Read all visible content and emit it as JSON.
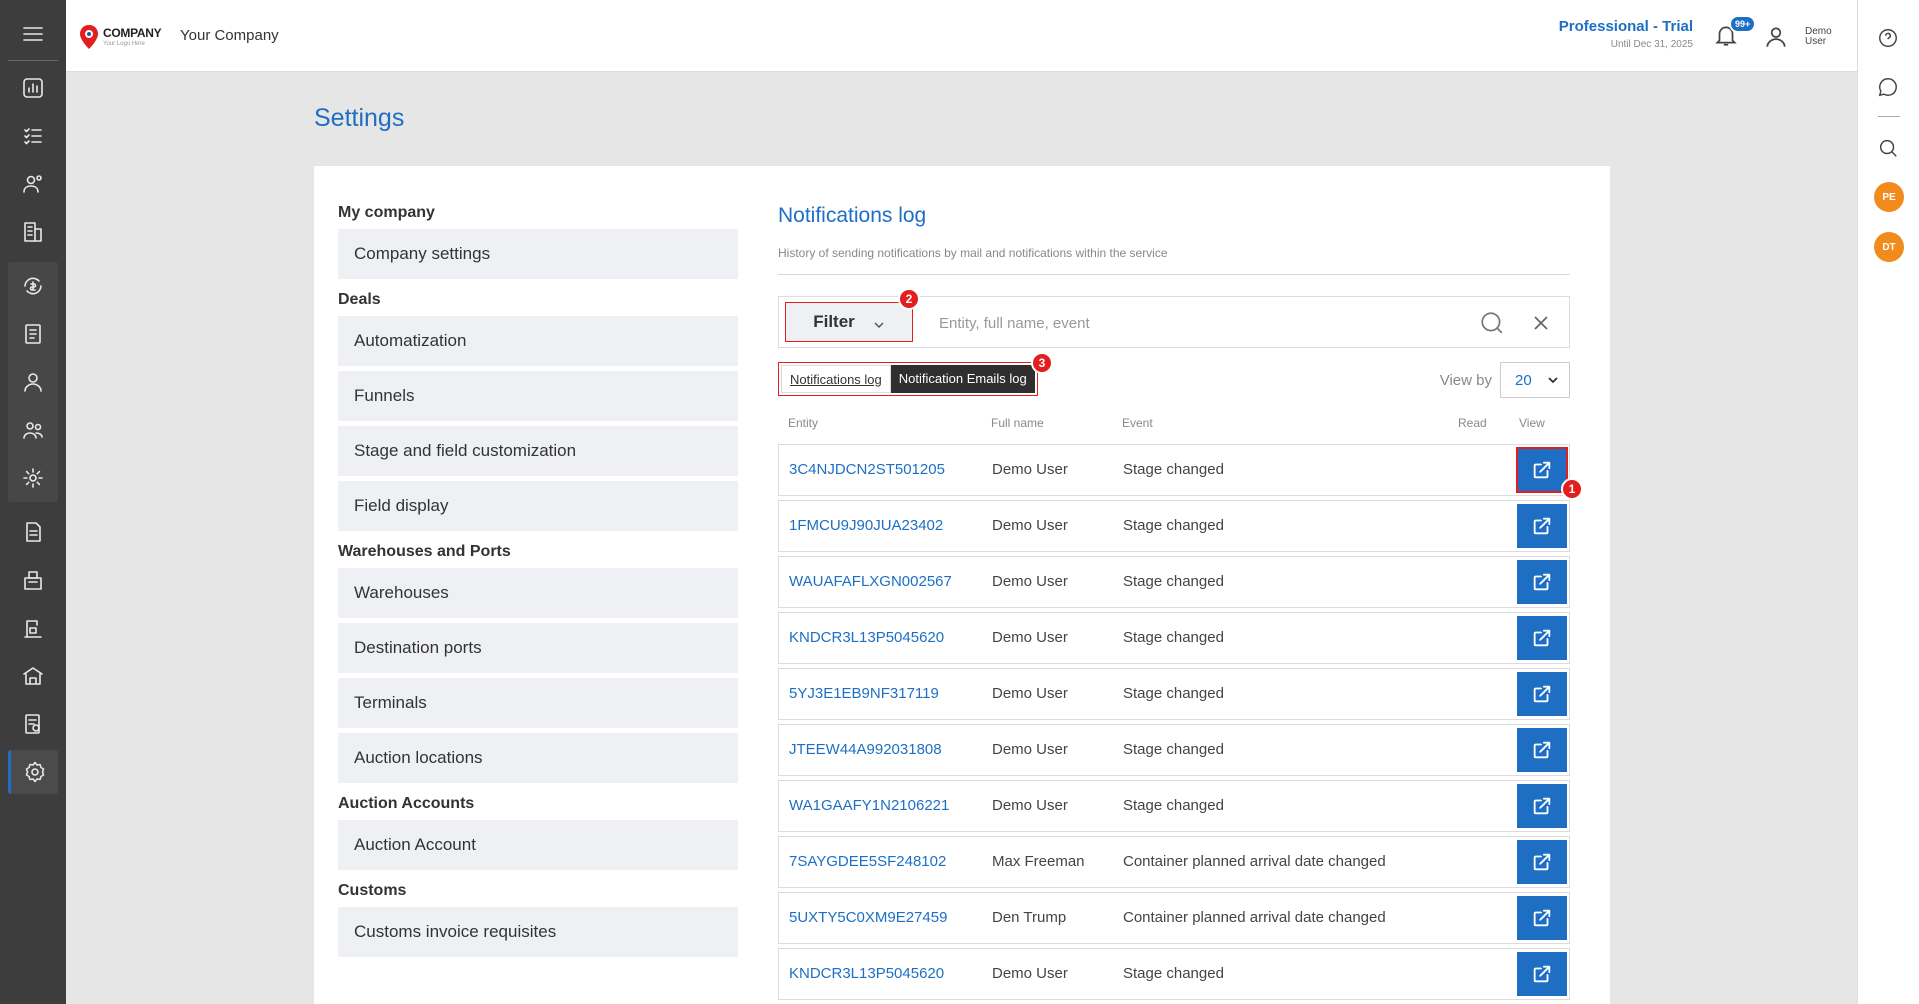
{
  "topbar": {
    "logo_main": "COMPANY",
    "logo_sub": "Your Logo Here",
    "company_name": "Your Company",
    "plan_title": "Professional - Trial",
    "plan_until": "Until Dec 31, 2025",
    "notification_count": "99+",
    "user_name": "Demo User"
  },
  "right_bar": {
    "avatars": [
      "PE",
      "DT"
    ]
  },
  "page": {
    "title": "Settings"
  },
  "settings_nav": {
    "my_company": {
      "title": "My company",
      "items": [
        "Company settings"
      ]
    },
    "deals": {
      "title": "Deals",
      "items": [
        "Automatization",
        "Funnels",
        "Stage and field customization",
        "Field display"
      ]
    },
    "warehouses": {
      "title": "Warehouses and Ports",
      "items": [
        "Warehouses",
        "Destination ports",
        "Terminals",
        "Auction locations"
      ]
    },
    "auction_accounts": {
      "title": "Auction Accounts",
      "items": [
        "Auction Account"
      ]
    },
    "customs": {
      "title": "Customs",
      "items": [
        "Customs invoice requisites"
      ]
    }
  },
  "content": {
    "title": "Notifications log",
    "description": "History of sending notifications by mail and notifications within the service",
    "filter_label": "Filter",
    "search_placeholder": "Entity, full name, event",
    "tabs": [
      "Notifications log",
      "Notification Emails log"
    ],
    "viewby_label": "View by",
    "viewby_value": "20",
    "badges": [
      "1",
      "2",
      "3"
    ],
    "columns": {
      "entity": "Entity",
      "full_name": "Full name",
      "event": "Event",
      "read": "Read",
      "view": "View"
    },
    "rows": [
      {
        "entity": "3C4NJDCN2ST501205",
        "full_name": "Demo User",
        "event": "Stage changed"
      },
      {
        "entity": "1FMCU9J90JUA23402",
        "full_name": "Demo User",
        "event": "Stage changed"
      },
      {
        "entity": "WAUAFAFLXGN002567",
        "full_name": "Demo User",
        "event": "Stage changed"
      },
      {
        "entity": "KNDCR3L13P5045620",
        "full_name": "Demo User",
        "event": "Stage changed"
      },
      {
        "entity": "5YJ3E1EB9NF317119",
        "full_name": "Demo User",
        "event": "Stage changed"
      },
      {
        "entity": "JTEEW44A992031808",
        "full_name": "Demo User",
        "event": "Stage changed"
      },
      {
        "entity": "WA1GAAFY1N2106221",
        "full_name": "Demo User",
        "event": "Stage changed"
      },
      {
        "entity": "7SAYGDEE5SF248102",
        "full_name": "Max Freeman",
        "event": "Container planned arrival date changed"
      },
      {
        "entity": "5UXTY5C0XM9E27459",
        "full_name": "Den Trump",
        "event": "Container planned arrival date changed"
      },
      {
        "entity": "KNDCR3L13P5045620",
        "full_name": "Demo User",
        "event": "Stage changed"
      }
    ]
  },
  "colors": {
    "accent": "#1e6fc4",
    "sidebar": "#3d3d3d",
    "highlight": "#e21e1e",
    "avatar": "#f28b1e"
  }
}
